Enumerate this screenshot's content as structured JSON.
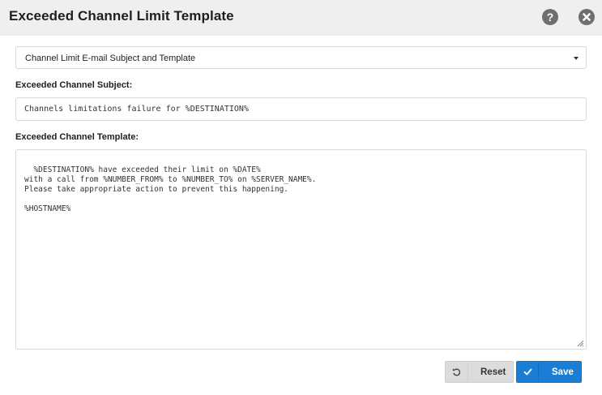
{
  "dialog": {
    "title": "Exceeded Channel Limit Template",
    "help_icon": "help-icon",
    "close_icon": "close-icon"
  },
  "template_select": {
    "selected": "Channel Limit E-mail Subject and Template"
  },
  "subject": {
    "label": "Exceeded Channel Subject:",
    "value": "Channels limitations failure for %DESTINATION%"
  },
  "template": {
    "label": "Exceeded Channel Template:",
    "value": "%DESTINATION% have exceeded their limit on %DATE%\nwith a call from %NUMBER_FROM% to %NUMBER_TO% on %SERVER_NAME%.\nPlease take appropriate action to prevent this happening.\n\n%HOSTNAME%"
  },
  "buttons": {
    "reset_label": "Reset",
    "reset_icon": "undo-icon",
    "save_label": "Save",
    "save_icon": "check-icon"
  },
  "colors": {
    "header_bg": "#efefef",
    "primary": "#1a7fd4",
    "secondary": "#dcdcdc"
  }
}
